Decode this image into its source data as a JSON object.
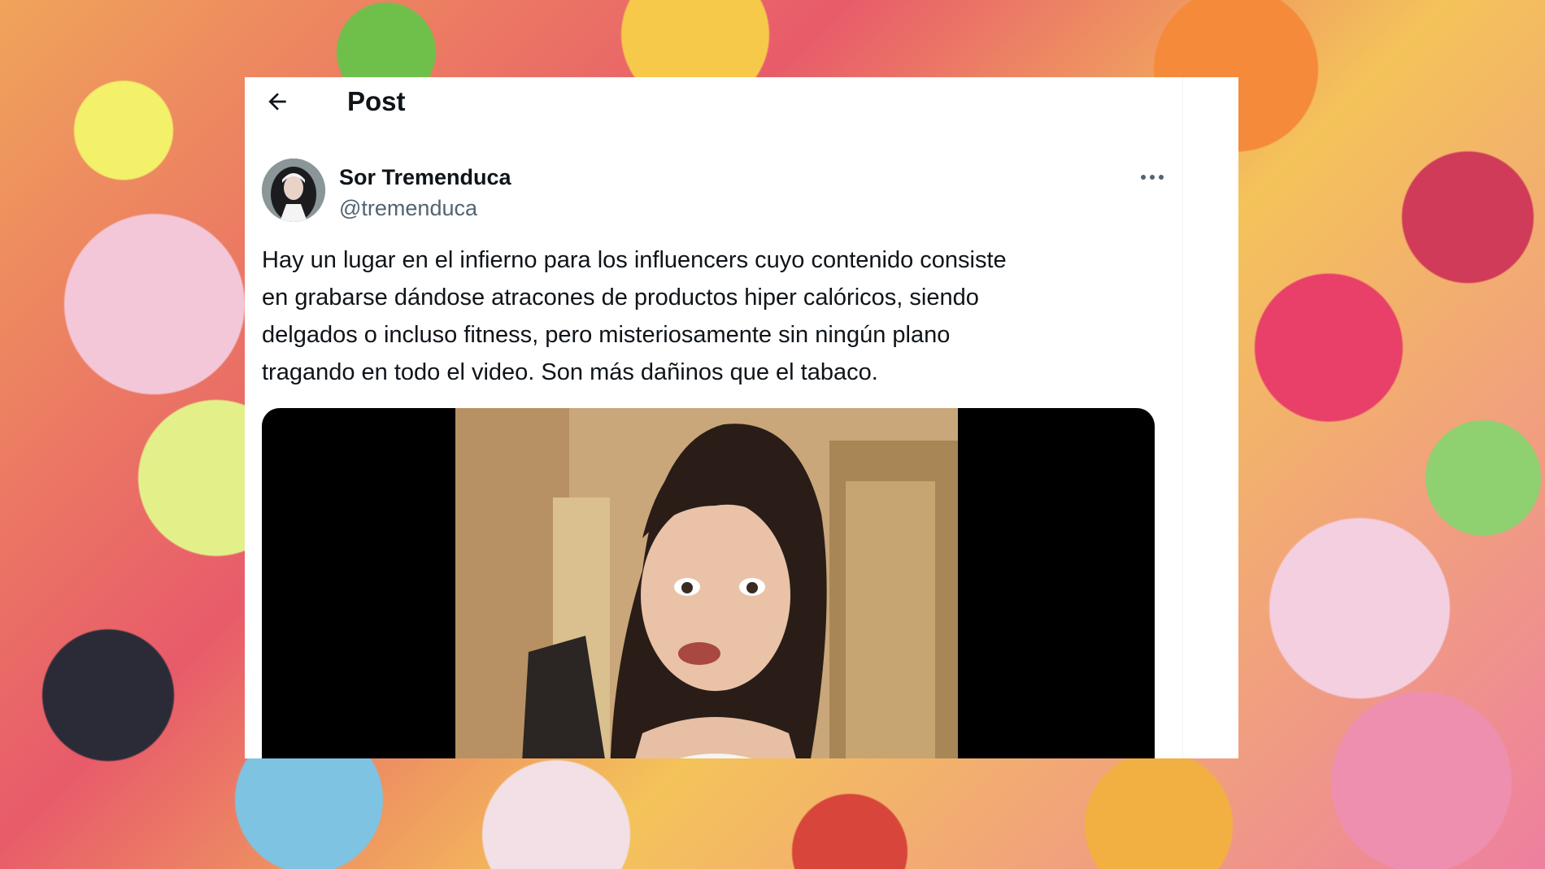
{
  "header": {
    "title": "Post",
    "back_icon": "arrow-left-icon"
  },
  "post": {
    "author_name": "Sor Tremenduca",
    "author_handle": "@tremenduca",
    "more_icon": "more-horizontal-icon",
    "text_lines": [
      "Hay un lugar en el infierno para los influencers cuyo contenido consiste",
      "en grabarse dándose atracones de productos hiper calóricos, siendo",
      "delgados o incluso fitness, pero misteriosamente sin ningún plano",
      "tragando en todo el video. Son más dañinos que el tabaco."
    ]
  },
  "colors": {
    "text_primary": "#0f1419",
    "text_secondary": "#536471",
    "media_bg": "#000000"
  }
}
